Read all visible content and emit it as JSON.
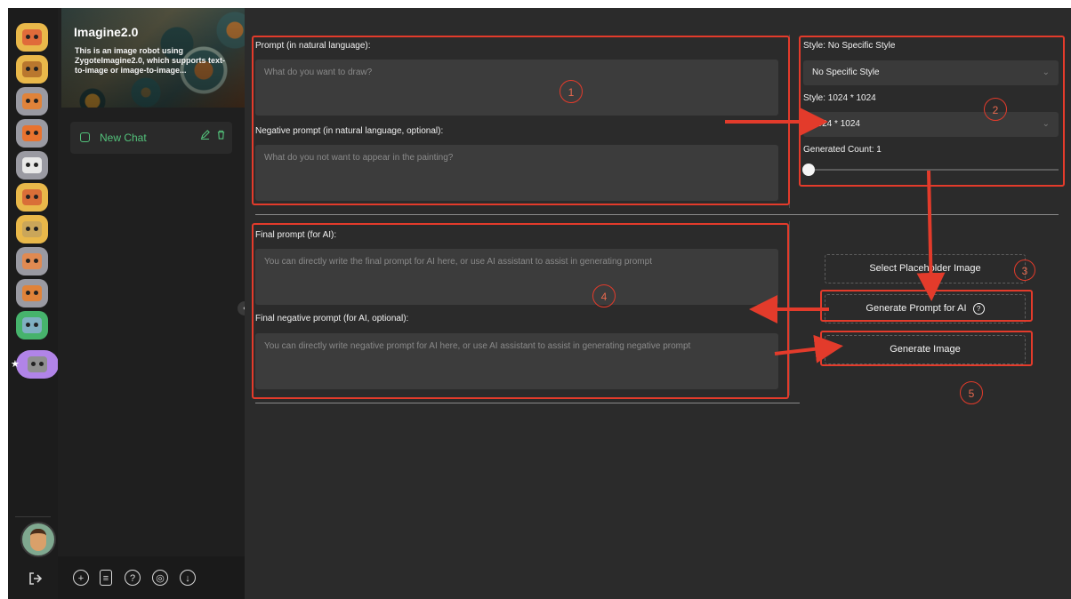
{
  "sidebar": {
    "bots": [
      {
        "color": "#e9b84a",
        "face": "#e06b3a"
      },
      {
        "color": "#e9b84a",
        "face": "#b9772e"
      },
      {
        "color": "#9a9aa2",
        "face": "#e0833a"
      },
      {
        "color": "#9a9aa2",
        "face": "#e8732f"
      },
      {
        "color": "#9a9aa2",
        "face": "#e8e8e8"
      },
      {
        "color": "#e9b84a",
        "face": "#d96e38"
      },
      {
        "color": "#e9b84a",
        "face": "#caa65a"
      },
      {
        "color": "#9a9aa2",
        "face": "#e08a52"
      },
      {
        "color": "#9a9aa2",
        "face": "#e0833a"
      },
      {
        "color": "#46b36c",
        "face": "#7fb0c2"
      },
      {
        "color": "#b184e8",
        "face": "#8f8f8f"
      }
    ],
    "active_marker": "★",
    "logout_icon": "logout-icon"
  },
  "bot_info": {
    "title": "Imagine2.0",
    "description": "This is an image robot using ZygoteImagine2.0, which supports text-to-image or image-to-image..."
  },
  "chats": [
    {
      "label": "New Chat"
    }
  ],
  "toolbar_icons": [
    "add-icon",
    "document-icon",
    "help-icon",
    "camera-icon",
    "download-icon"
  ],
  "prompt": {
    "label": "Prompt (in natural language):",
    "placeholder": "What do you want to draw?",
    "negative_label": "Negative prompt (in natural language, optional):",
    "negative_placeholder": "What do you not want to appear in the painting?"
  },
  "settings": {
    "style_label": "Style: No Specific Style",
    "style_value": "No Specific Style",
    "size_label": "Style: 1024 * 1024",
    "size_value": "1024 * 1024",
    "count_label": "Generated Count: 1",
    "count_fraction": 0
  },
  "final": {
    "label": "Final prompt (for AI):",
    "placeholder": "You can directly write the final prompt for AI here, or use AI assistant to assist in generating prompt",
    "negative_label": "Final negative prompt (for AI, optional):",
    "negative_placeholder": "You can directly write negative prompt for AI here, or use AI assistant to assist in generating negative prompt"
  },
  "actions": {
    "select_placeholder": "Select Placeholder Image",
    "generate_prompt": "Generate Prompt for AI",
    "generate_prompt_icon": "help-circle-icon",
    "generate_image": "Generate Image"
  },
  "annotations": {
    "numbers": [
      "1",
      "2",
      "3",
      "4",
      "5"
    ],
    "color": "#e33b2b"
  }
}
